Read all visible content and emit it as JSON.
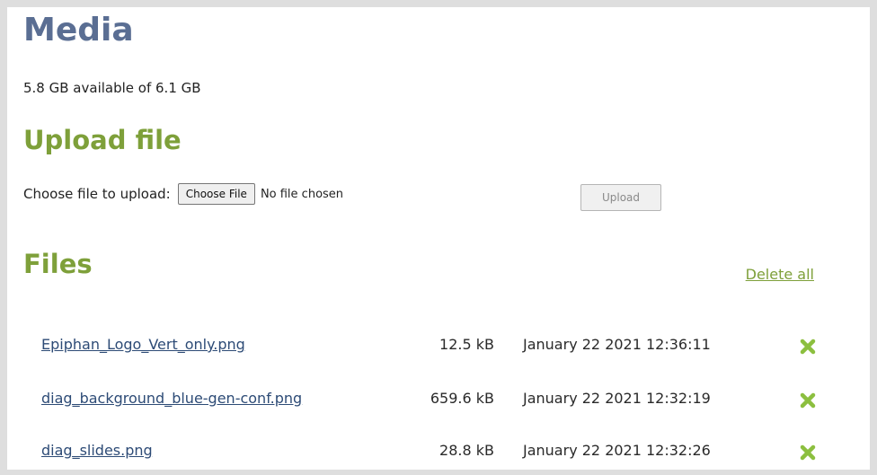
{
  "media": {
    "title": "Media",
    "storage": "5.8 GB available of 6.1 GB"
  },
  "upload": {
    "title": "Upload file",
    "choose_label": "Choose file to upload:",
    "choose_button": "Choose File",
    "no_file": "No file chosen",
    "upload_button": "Upload"
  },
  "files": {
    "title": "Files",
    "delete_all": "Delete all",
    "items": [
      {
        "name": "Epiphan_Logo_Vert_only.png",
        "size": "12.5 kB",
        "date": "January 22 2021 12:36:11",
        "delete_icon": "green-x-icon"
      },
      {
        "name": "diag_background_blue-gen-conf.png",
        "size": "659.6 kB",
        "date": "January 22 2021 12:32:19",
        "delete_icon": "green-x-icon"
      },
      {
        "name": "diag_slides.png",
        "size": "28.8 kB",
        "date": "January 22 2021 12:32:26",
        "delete_icon": "green-x-icon"
      }
    ]
  },
  "colors": {
    "media_heading": "#5a6e93",
    "section_heading": "#7ea03a",
    "link": "#2d4b76",
    "delete_icon": "#8cbf3f"
  }
}
